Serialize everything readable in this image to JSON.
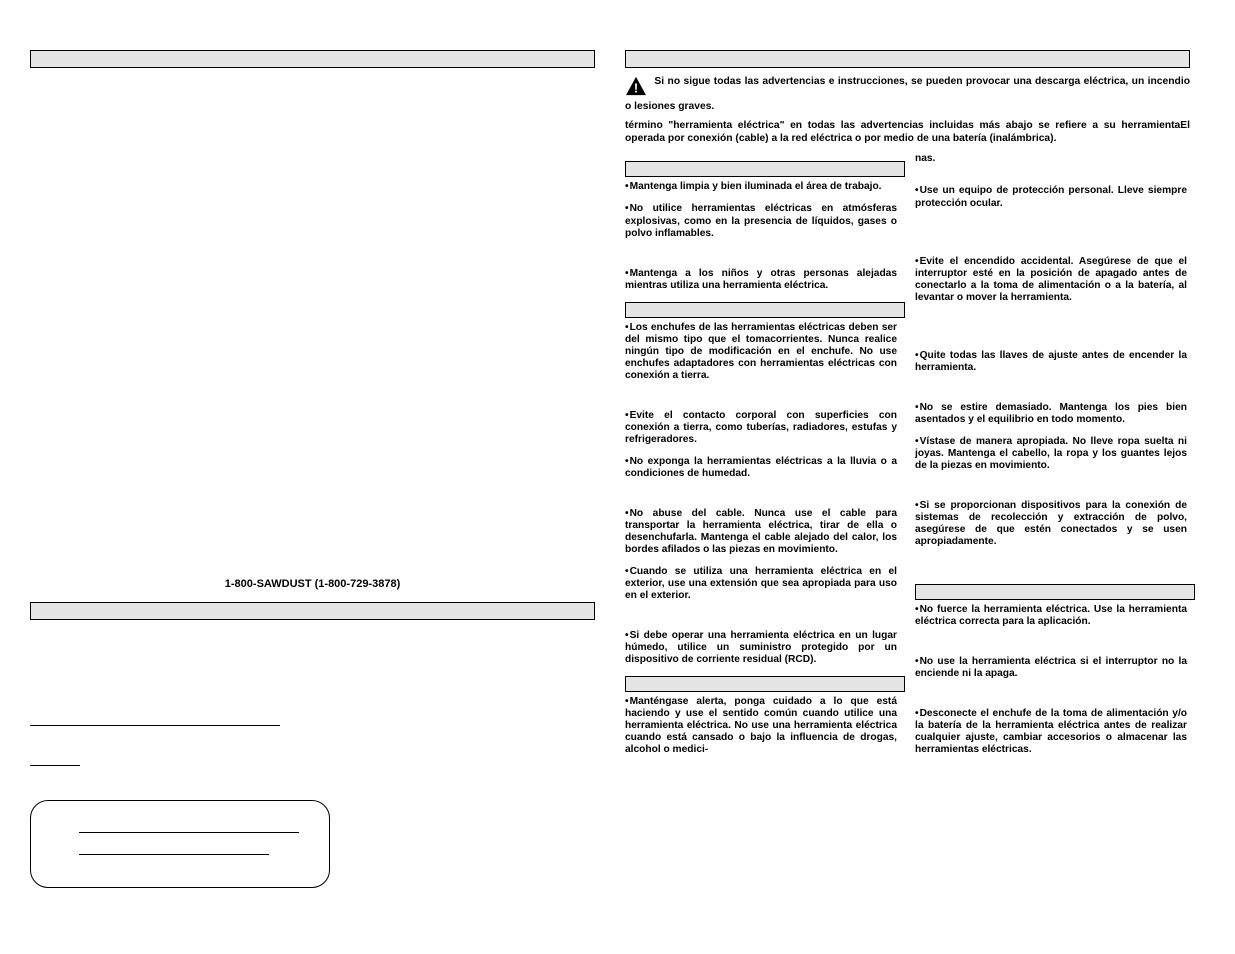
{
  "left": {
    "phone": "1-800-SAWDUST (1-800-729-3878)"
  },
  "right": {
    "warning_text": "Si no sigue todas las advertencias e instrucciones, se pueden provocar una descarga eléctrica, un incendio o lesiones graves.",
    "el": "El",
    "intro": "término \"herramienta eléctrica\" en todas las advertencias incluidas más abajo se refiere a su herramienta operada por conexión (cable) a la red eléctrica o por medio de una batería (inalámbrica).",
    "nas": "nas.",
    "col1": {
      "b1_lead": "Mantenga limpia y bien iluminada el área de trabajo.",
      "b2_lead": "No utilice herramientas eléctricas en atmósferas explosivas, como en la presencia de líquidos, gases o polvo inflamables.",
      "b3_lead": "Mantenga a los niños y otras personas alejadas mientras utiliza una herramienta eléctrica.",
      "b4_lead": "Los enchufes de las herramientas eléctricas deben ser del mismo tipo que el tomacorrientes. Nunca realice ningún tipo de modificación en el enchufe. No use enchufes adaptadores con herramientas eléctricas con conexión a tierra.",
      "b5_lead": "Evite el contacto corporal con superficies con conexión a tierra, como tuberías, radiadores, estufas y refrigeradores.",
      "b6_lead": "No exponga la herramientas eléctricas a la lluvia o a condiciones de humedad.",
      "b7_lead": "No abuse del cable. Nunca use el cable para transportar la herramienta eléctrica, tirar de ella o desenchufarla. Mantenga el cable alejado del calor, los bordes afilados o las piezas en movimiento.",
      "b8_lead": "Cuando se utiliza una herramienta eléctrica en el exterior, use una extensión  que sea apropiada para uso en el exterior.",
      "b9_lead": "Si debe operar una herramienta eléctrica en un lugar húmedo, utilice un suministro protegido por un dispositivo de corriente residual (RCD).",
      "b10_lead": "Manténgase alerta, ponga cuidado a lo que está haciendo y use el sentido común cuando utilice una herramienta eléctrica. No use una herramienta eléctrica cuando está cansado o bajo la influencia de drogas, alcohol o medici-"
    },
    "col2": {
      "b1_lead": "Use un equipo de protección personal. Lleve siempre protección ocular.",
      "b2_lead": "Evite el encendido accidental. Asegúrese de que el interruptor esté en la posición de apagado antes de conectarlo a la toma de alimentación o a la batería, al levantar o mover la herramienta.",
      "b3_lead": "Quite todas las llaves de ajuste antes de encender la herramienta.",
      "b4_lead": "No se estire demasiado. Mantenga los pies bien asentados y el equilibrio en todo momento.",
      "b5_lead": "Vístase de manera apropiada. No lleve ropa suelta ni joyas. Mantenga el cabello, la ropa y los guantes lejos de la piezas en movimiento.",
      "b6_lead": "Si se proporcionan dispositivos para la conexión de sistemas de recolección y extracción de polvo, asegúrese de que estén conectados y se usen apropiadamente.",
      "b7_lead": "No fuerce la herramienta eléctrica. Use la herramienta eléctrica correcta para la aplicación.",
      "b8_lead": "No use la herramienta eléctrica si el interruptor no la enciende ni la apaga.",
      "b9_lead": "Desconecte el enchufe de la toma de alimentación y/o la batería de la herramienta eléctrica antes de realizar cualquier ajuste, cambiar accesorios o almacenar las herramientas eléctricas."
    }
  }
}
